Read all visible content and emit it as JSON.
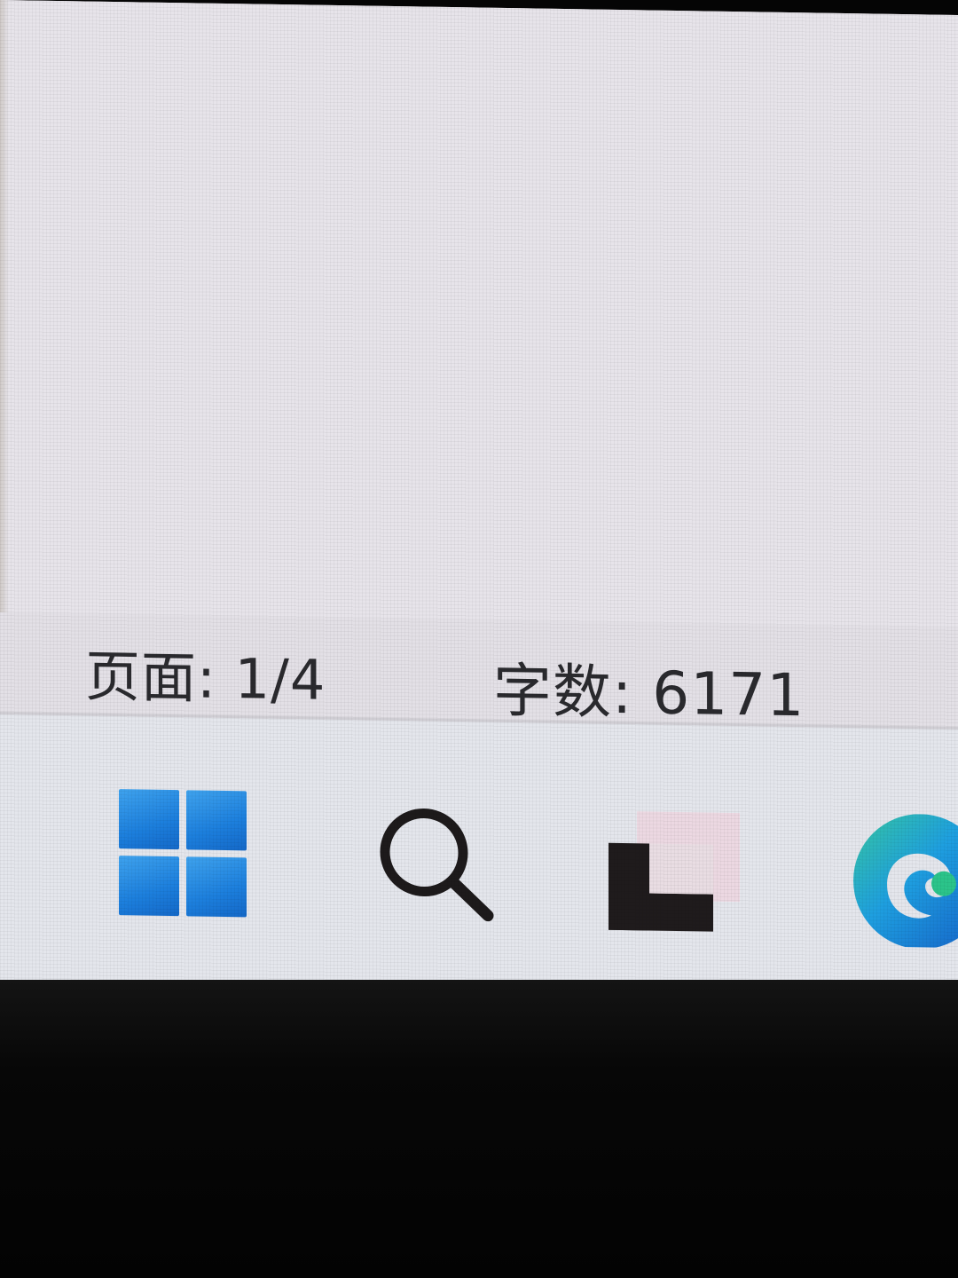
{
  "status_bar": {
    "pages": "页面: 1/4",
    "words": "字数: 6171"
  },
  "taskbar": {
    "icons": [
      {
        "name": "windows-start-icon"
      },
      {
        "name": "search-icon"
      },
      {
        "name": "task-view-icon"
      },
      {
        "name": "edge-browser-icon"
      }
    ]
  },
  "colors": {
    "start_blue": "#1c7fdd",
    "edge_blue": "#1a7fd6",
    "edge_green": "#2bc48a",
    "text": "#2a2a2e",
    "screen_bg": "#e7e4ea"
  }
}
